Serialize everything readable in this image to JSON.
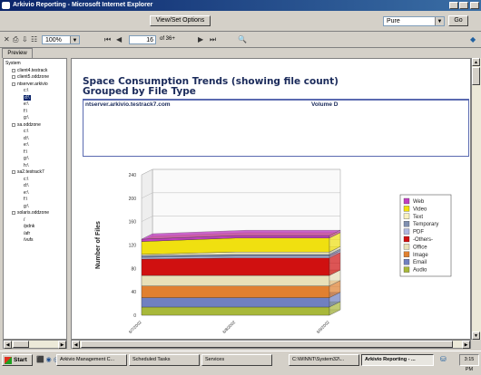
{
  "window": {
    "title": "Arkivio Reporting - Microsoft Internet Explorer"
  },
  "toolbar": {
    "view_set_options": "View/Set Options",
    "format_select": "Pure",
    "go_label": "Go",
    "zoom": "100%",
    "page_current": "16",
    "page_total": "of 36+"
  },
  "tabs": {
    "preview": "Preview"
  },
  "tree": {
    "items": [
      {
        "label": "System",
        "indent": 0,
        "selected": false
      },
      {
        "label": "client4.testrack",
        "indent": 1,
        "selected": false
      },
      {
        "label": "client5.oddzone",
        "indent": 1,
        "selected": false
      },
      {
        "label": "ntserver.arkivio",
        "indent": 1,
        "selected": false
      },
      {
        "label": "c:\\",
        "indent": 2,
        "selected": false
      },
      {
        "label": "d:\\",
        "indent": 2,
        "selected": true
      },
      {
        "label": "e:\\",
        "indent": 2,
        "selected": false
      },
      {
        "label": "f:\\",
        "indent": 2,
        "selected": false
      },
      {
        "label": "g:\\",
        "indent": 2,
        "selected": false
      },
      {
        "label": "sa.oddzone",
        "indent": 1,
        "selected": false
      },
      {
        "label": "c:\\",
        "indent": 2,
        "selected": false
      },
      {
        "label": "d:\\",
        "indent": 2,
        "selected": false
      },
      {
        "label": "e:\\",
        "indent": 2,
        "selected": false
      },
      {
        "label": "f:\\",
        "indent": 2,
        "selected": false
      },
      {
        "label": "g:\\",
        "indent": 2,
        "selected": false
      },
      {
        "label": "h:\\",
        "indent": 2,
        "selected": false
      },
      {
        "label": "sa2.testrack7",
        "indent": 1,
        "selected": false
      },
      {
        "label": "c:\\",
        "indent": 2,
        "selected": false
      },
      {
        "label": "d:\\",
        "indent": 2,
        "selected": false
      },
      {
        "label": "e:\\",
        "indent": 2,
        "selected": false
      },
      {
        "label": "f:\\",
        "indent": 2,
        "selected": false
      },
      {
        "label": "g:\\",
        "indent": 2,
        "selected": false
      },
      {
        "label": "solaris.oddzone",
        "indent": 1,
        "selected": false
      },
      {
        "label": "/",
        "indent": 2,
        "selected": false
      },
      {
        "label": "/pdnk",
        "indent": 2,
        "selected": false
      },
      {
        "label": "/afr",
        "indent": 2,
        "selected": false
      },
      {
        "label": "/vufs",
        "indent": 2,
        "selected": false
      }
    ]
  },
  "report": {
    "title": "Space Consumption Trends (showing file count) Grouped by File Type",
    "server": "ntserver.arkivio.testrack7.com",
    "volume": "Volume D"
  },
  "chart_data": {
    "type": "area",
    "stacked": true,
    "three_d": true,
    "ylabel": "Number of Files",
    "xlabel": "",
    "ylim": [
      0,
      240
    ],
    "yticks": [
      0,
      40,
      80,
      120,
      160,
      200,
      240
    ],
    "categories": [
      "6/7/2002",
      "6/8/2002",
      "6/9/2002"
    ],
    "legend_position": "right",
    "series": [
      {
        "name": "Audio",
        "color": "#a8b83a",
        "values": [
          14,
          14,
          14
        ]
      },
      {
        "name": "Email",
        "color": "#7080c0",
        "values": [
          16,
          16,
          16
        ]
      },
      {
        "name": "Image",
        "color": "#e08030",
        "values": [
          20,
          20,
          20
        ]
      },
      {
        "name": "Office",
        "color": "#e8e0b8",
        "values": [
          18,
          18,
          18
        ]
      },
      {
        "name": "-Others-",
        "color": "#d01010",
        "values": [
          28,
          30,
          30
        ]
      },
      {
        "name": "PDF",
        "color": "#b0b8e0",
        "values": [
          3,
          3,
          3
        ]
      },
      {
        "name": "Temporary",
        "color": "#8090b0",
        "values": [
          3,
          3,
          3
        ]
      },
      {
        "name": "Text",
        "color": "#f8f0c0",
        "values": [
          2,
          4,
          4
        ]
      },
      {
        "name": "Video",
        "color": "#f0e010",
        "values": [
          22,
          24,
          24
        ]
      },
      {
        "name": "Web",
        "color": "#c040c0",
        "values": [
          4,
          4,
          4
        ]
      }
    ]
  },
  "taskbar": {
    "start": "Start",
    "tasks": [
      {
        "label": "Arkivio Management C...",
        "active": false
      },
      {
        "label": "Scheduled Tasks",
        "active": false
      },
      {
        "label": "Services",
        "active": false
      },
      {
        "label": "C:\\WINNT\\System32\\...",
        "active": false
      },
      {
        "label": "Arkivio Reporting - ...",
        "active": true
      }
    ],
    "clock": "3:15 PM"
  }
}
